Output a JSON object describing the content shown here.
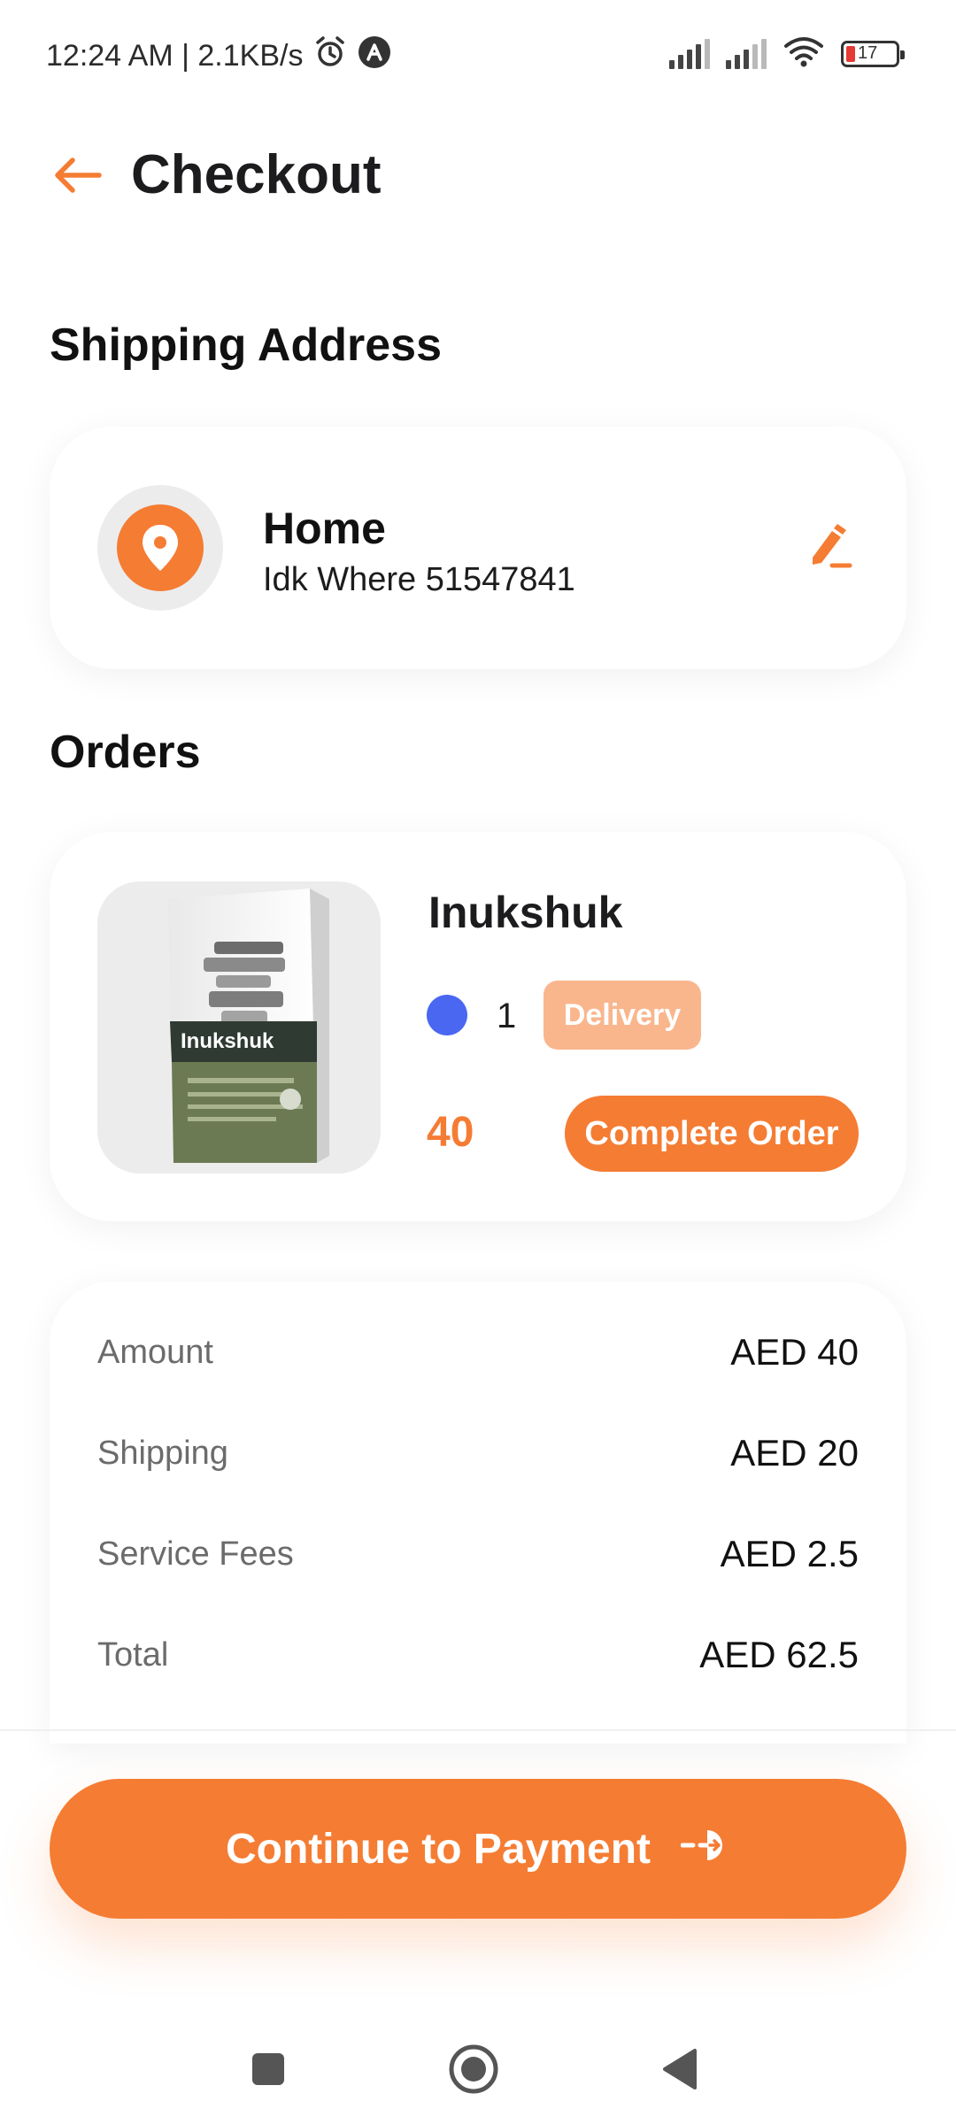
{
  "status_bar": {
    "time_speed": "12:24 AM | 2.1KB/s",
    "battery_level": "17"
  },
  "header": {
    "title": "Checkout"
  },
  "shipping": {
    "section_title": "Shipping Address",
    "address_name": "Home",
    "address_line": "Idk Where 51547841"
  },
  "orders": {
    "section_title": "Orders",
    "items": [
      {
        "product_name": "Inukshuk",
        "color": "#4a67f2",
        "quantity": "1",
        "delivery_label": "Delivery",
        "price": "40",
        "complete_label": "Complete Order",
        "image_text": "Inukshuk"
      }
    ]
  },
  "summary": {
    "rows": [
      {
        "label": "Amount",
        "value": "AED 40"
      },
      {
        "label": "Shipping",
        "value": "AED 20"
      },
      {
        "label": "Service Fees",
        "value": "AED 2.5"
      },
      {
        "label": "Total",
        "value": "AED 62.5"
      }
    ]
  },
  "cta": {
    "label": "Continue to Payment"
  },
  "colors": {
    "accent": "#f57c33",
    "accent_light": "#f9b68d"
  },
  "icons": {
    "back": "arrow-left-icon",
    "location": "location-pin-icon",
    "edit": "pencil-icon",
    "pay": "arrow-right-circle-icon",
    "nav_recents": "square-icon",
    "nav_home": "circle-icon",
    "nav_back": "triangle-back-icon"
  }
}
